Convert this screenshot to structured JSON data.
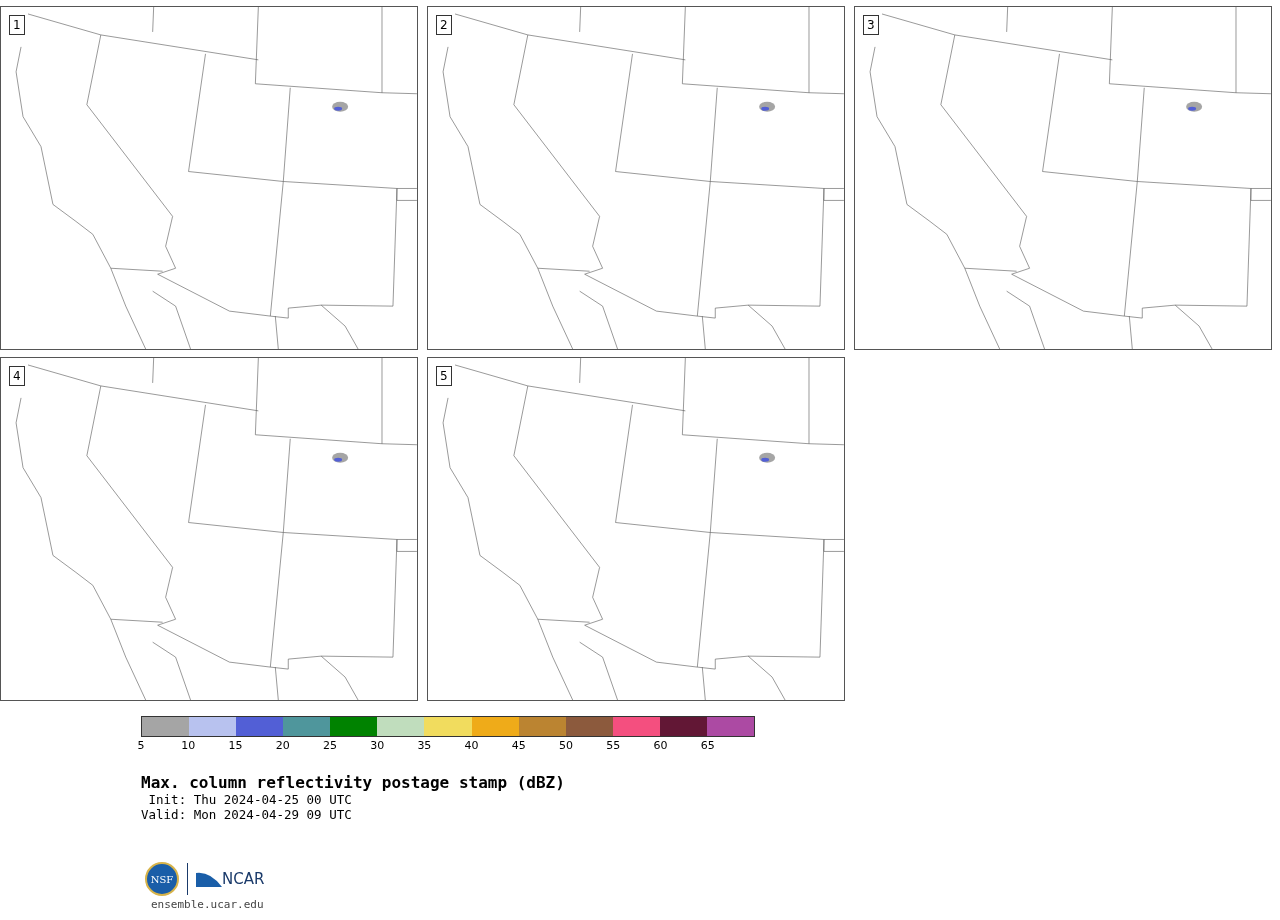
{
  "panels": [
    {
      "label": "1"
    },
    {
      "label": "2"
    },
    {
      "label": "3"
    },
    {
      "label": "4"
    },
    {
      "label": "5"
    }
  ],
  "colorbar": {
    "bins": [
      {
        "color": "#a5a5a5"
      },
      {
        "color": "#b8c2ef"
      },
      {
        "color": "#525fd6"
      },
      {
        "color": "#4f969c"
      },
      {
        "color": "#008200"
      },
      {
        "color": "#c0ddbd"
      },
      {
        "color": "#f1dc5e"
      },
      {
        "color": "#efab19"
      },
      {
        "color": "#bb8431"
      },
      {
        "color": "#8c5a3d"
      },
      {
        "color": "#f44f7f"
      },
      {
        "color": "#621735"
      },
      {
        "color": "#ac4aa3"
      }
    ],
    "tick_labels": [
      "5",
      "10",
      "15",
      "20",
      "25",
      "30",
      "35",
      "40",
      "45",
      "50",
      "55",
      "60",
      "65"
    ]
  },
  "title": "Max. column reflectivity postage stamp (dBZ)",
  "init": " Init: Thu 2024-04-25 00 UTC",
  "valid": "Valid: Mon 2024-04-29 09 UTC",
  "logo": {
    "nsf": "NSF",
    "ncar": "NCAR",
    "site": "ensemble.ucar.edu"
  }
}
